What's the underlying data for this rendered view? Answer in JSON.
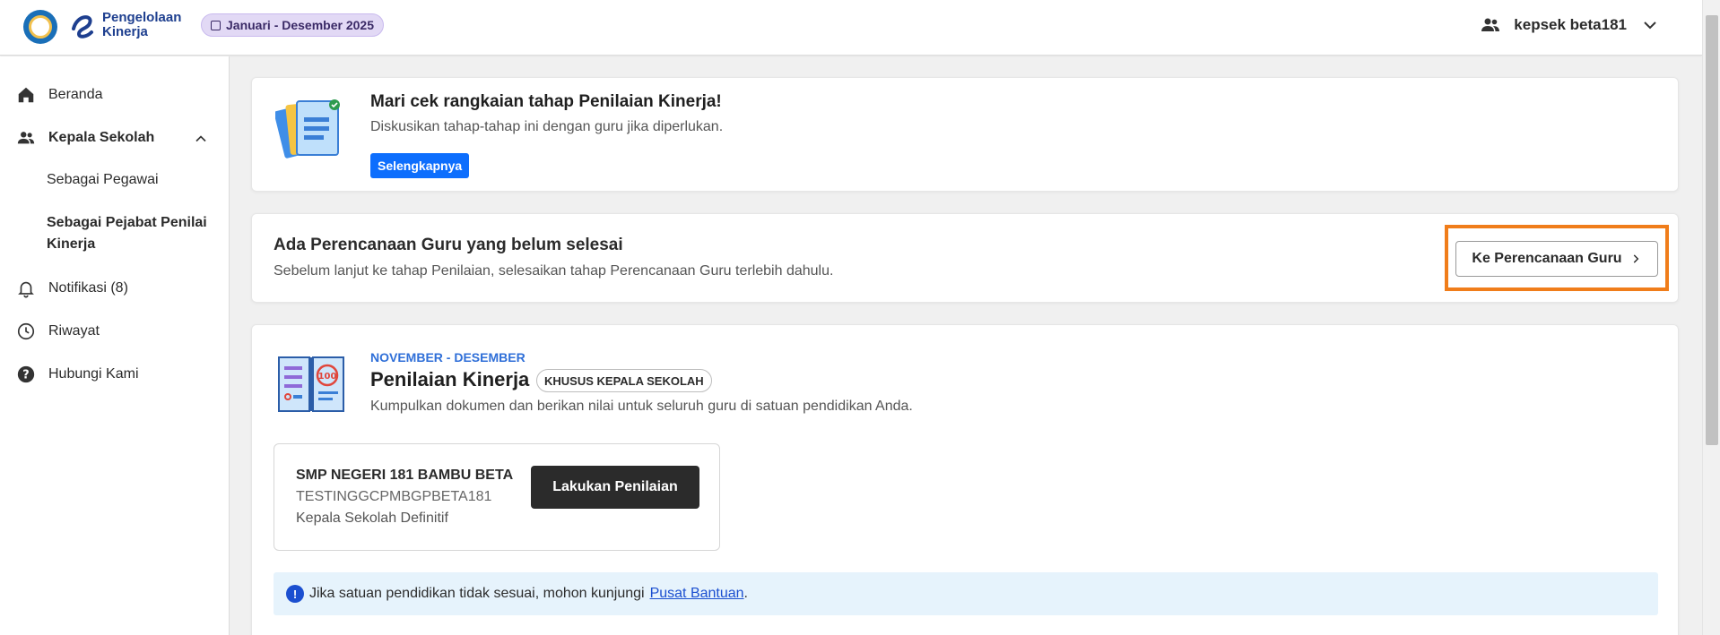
{
  "header": {
    "brand_line1": "Pengelolaan",
    "brand_line2": "Kinerja",
    "period": "Januari - Desember 2025",
    "user_name": "kepsek beta181"
  },
  "sidebar": {
    "items": [
      {
        "label": "Beranda",
        "icon": "home-icon"
      },
      {
        "label": "Kepala Sekolah",
        "icon": "people-icon"
      },
      {
        "label": "Sebagai Pegawai"
      },
      {
        "label": "Sebagai Pejabat Penilai Kinerja"
      },
      {
        "label": "Notifikasi (8)",
        "icon": "bell-icon"
      },
      {
        "label": "Riwayat",
        "icon": "clock-icon"
      },
      {
        "label": "Hubungi Kami",
        "icon": "help-icon"
      }
    ]
  },
  "intro_card": {
    "title": "Mari cek rangkaian tahap Penilaian Kinerja!",
    "description": "Diskusikan tahap-tahap ini dengan guru jika diperlukan.",
    "button": "Selengkapnya"
  },
  "planning_card": {
    "title": "Ada Perencanaan Guru yang belum selesai",
    "description": "Sebelum lanjut ke tahap Penilaian, selesaikan tahap Perencanaan Guru terlebih dahulu.",
    "button": "Ke Perencanaan Guru"
  },
  "assessment_card": {
    "period": "NOVEMBER - DESEMBER",
    "title": "Penilaian Kinerja",
    "pill": "KHUSUS KEPALA SEKOLAH",
    "description": "Kumpulkan dokumen dan berikan nilai untuk seluruh guru di satuan pendidikan Anda.",
    "school": {
      "name": "SMP NEGERI 181 BAMBU BETA",
      "code": "TESTINGGCPMBGPBETA181",
      "role": "Kepala Sekolah Definitif",
      "button": "Lakukan Penilaian"
    },
    "info": {
      "text": "Jika satuan pendidikan tidak sesuai, mohon kunjungi",
      "link": "Pusat Bantuan",
      "suffix": "."
    }
  },
  "colors": {
    "primary_button": "#0d6efd",
    "highlight": "#f07d1a",
    "dark_button": "#2b2b2b",
    "link": "#1b4fd0",
    "kicker": "#2f6fd8",
    "period_badge": "#e2d9f5"
  }
}
